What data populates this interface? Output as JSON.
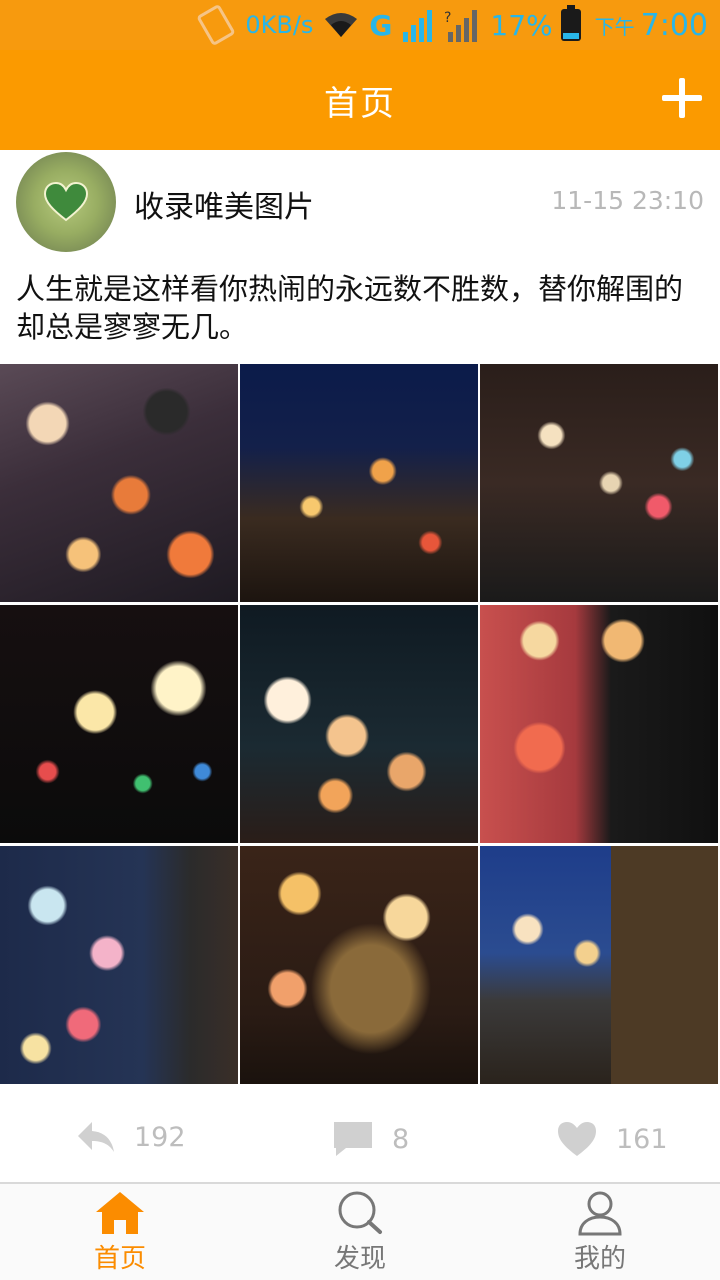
{
  "status_bar": {
    "net_speed": "0KB/s",
    "network_type": "G",
    "battery": "17%",
    "ampm": "下午",
    "time": "7:00",
    "icons": [
      "vibrate-icon",
      "wifi-icon",
      "signal-icon",
      "signal-unknown-icon",
      "battery-icon"
    ]
  },
  "app_bar": {
    "title": "首页",
    "add_icon": "plus-icon"
  },
  "post": {
    "author": "收录唯美图片",
    "time": "11-15 23:10",
    "text": "人生就是这样看你热闹的永远数不胜数，替你解围的却总是寥寥无几。",
    "photos": [
      "bokeh-traffic-light",
      "night-street",
      "tree-lights",
      "star-lights",
      "bokeh-dark-sky",
      "camera-bokeh",
      "city-lights-man",
      "book-heart",
      "bench-city"
    ],
    "actions": {
      "repost_count": "192",
      "comment_count": "8",
      "like_count": "161"
    }
  },
  "bottom_nav": {
    "tabs": [
      {
        "label": "首页",
        "icon": "home-icon",
        "active": true
      },
      {
        "label": "发现",
        "icon": "search-icon",
        "active": false
      },
      {
        "label": "我的",
        "icon": "profile-icon",
        "active": false
      }
    ]
  },
  "colors": {
    "brand": "#fb9a00",
    "status_text": "#29b6e8",
    "active_tab": "#fb8c00"
  }
}
